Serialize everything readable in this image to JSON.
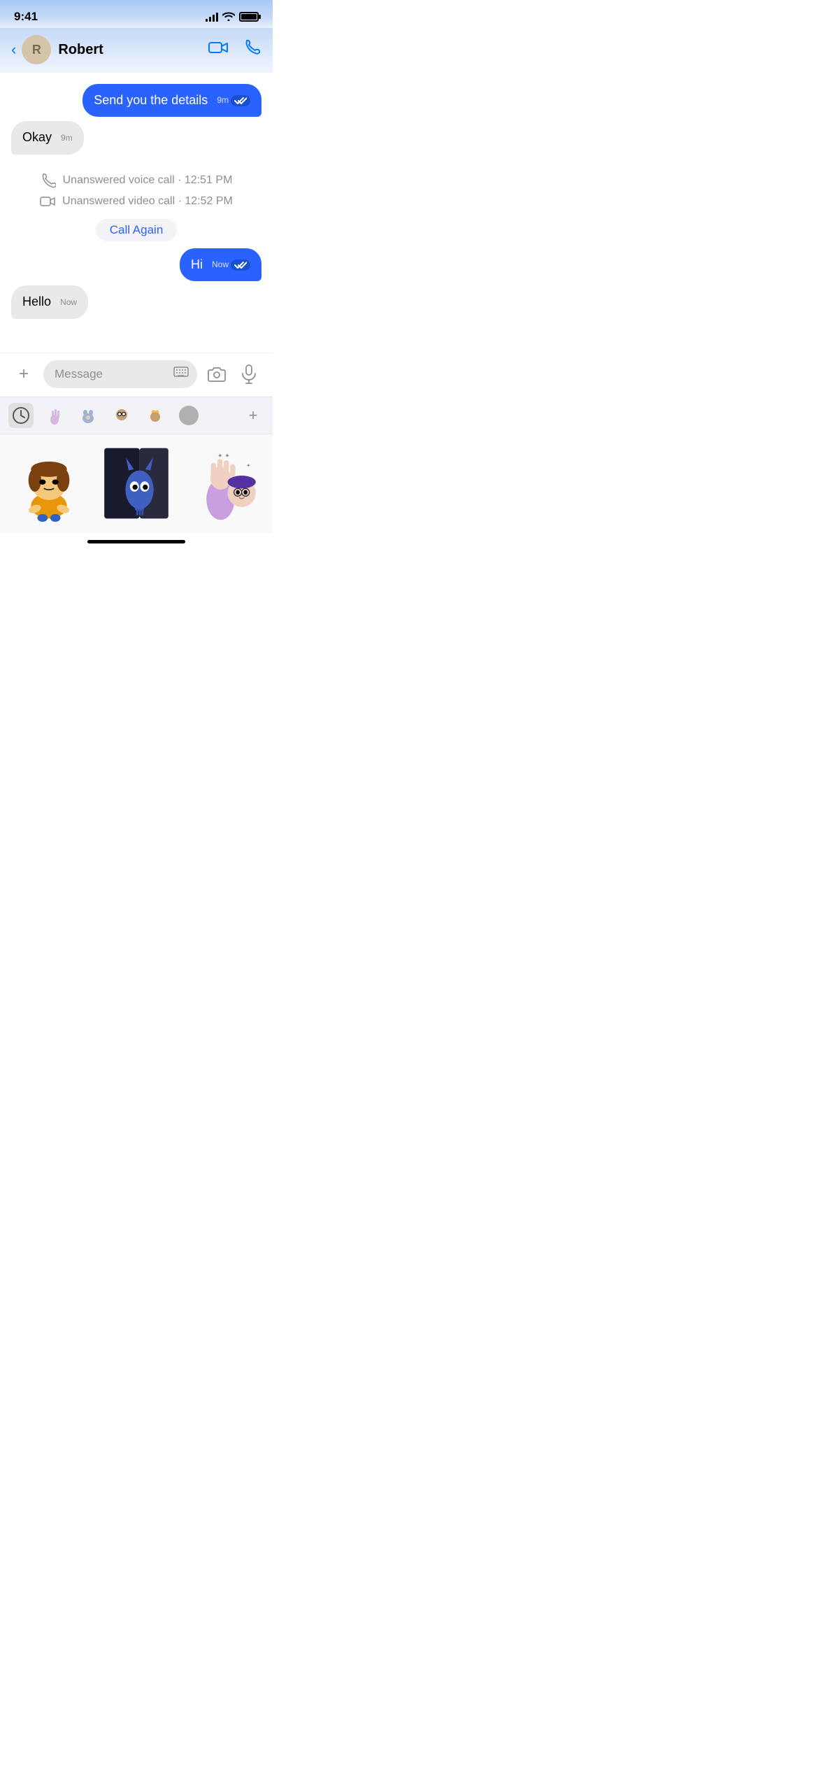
{
  "statusBar": {
    "time": "9:41",
    "battery": "100"
  },
  "header": {
    "backLabel": "‹",
    "avatarInitial": "R",
    "contactName": "Robert",
    "videoCallAriaLabel": "video call",
    "phoneCallAriaLabel": "phone call"
  },
  "messages": [
    {
      "id": "msg1",
      "type": "outgoing",
      "text": "Send you the details",
      "time": "9m",
      "readStatus": "read"
    },
    {
      "id": "msg2",
      "type": "incoming",
      "text": "Okay",
      "time": "9m"
    },
    {
      "id": "call1",
      "type": "call",
      "voiceText": "Unanswered voice call · 12:51 PM",
      "videoText": "Unanswered video call · 12:52 PM",
      "callAgainLabel": "Call Again"
    },
    {
      "id": "msg3",
      "type": "outgoing",
      "text": "Hi",
      "time": "Now",
      "readStatus": "read"
    },
    {
      "id": "msg4",
      "type": "incoming",
      "text": "Hello",
      "time": "Now"
    }
  ],
  "inputArea": {
    "placeholder": "Message",
    "addLabel": "+",
    "cameraAriaLabel": "camera",
    "micAriaLabel": "microphone"
  },
  "stickerTray": {
    "tabs": [
      {
        "id": "recent",
        "type": "recent",
        "active": true
      },
      {
        "id": "tab1",
        "type": "emoji1"
      },
      {
        "id": "tab2",
        "type": "emoji2"
      },
      {
        "id": "tab3",
        "type": "emoji3"
      },
      {
        "id": "tab4",
        "type": "emoji4"
      },
      {
        "id": "dot",
        "type": "dot"
      }
    ],
    "addLabel": "+"
  }
}
